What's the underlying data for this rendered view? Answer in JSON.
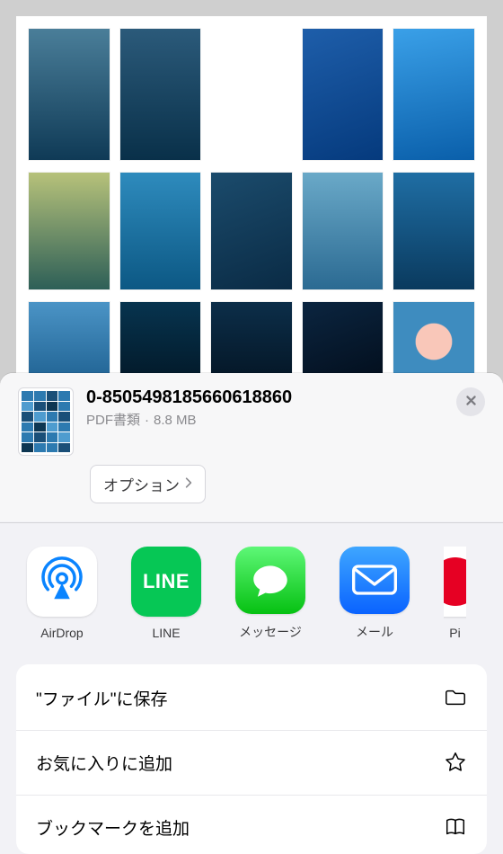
{
  "document": {
    "filename": "0-8505498185660618860",
    "type_label": "PDF書類",
    "size_label": "8.8 MB",
    "options_button_label": "オプション"
  },
  "share_apps": [
    {
      "id": "airdrop",
      "label": "AirDrop"
    },
    {
      "id": "line",
      "label": "LINE"
    },
    {
      "id": "messages",
      "label": "メッセージ"
    },
    {
      "id": "mail",
      "label": "メール"
    },
    {
      "id": "extra",
      "label": "Pi"
    }
  ],
  "actions": [
    {
      "id": "save-to-files",
      "label": "\"ファイル\"に保存",
      "icon": "folder"
    },
    {
      "id": "add-favorite",
      "label": "お気に入りに追加",
      "icon": "star"
    },
    {
      "id": "add-bookmark",
      "label": "ブックマークを追加",
      "icon": "book"
    }
  ]
}
